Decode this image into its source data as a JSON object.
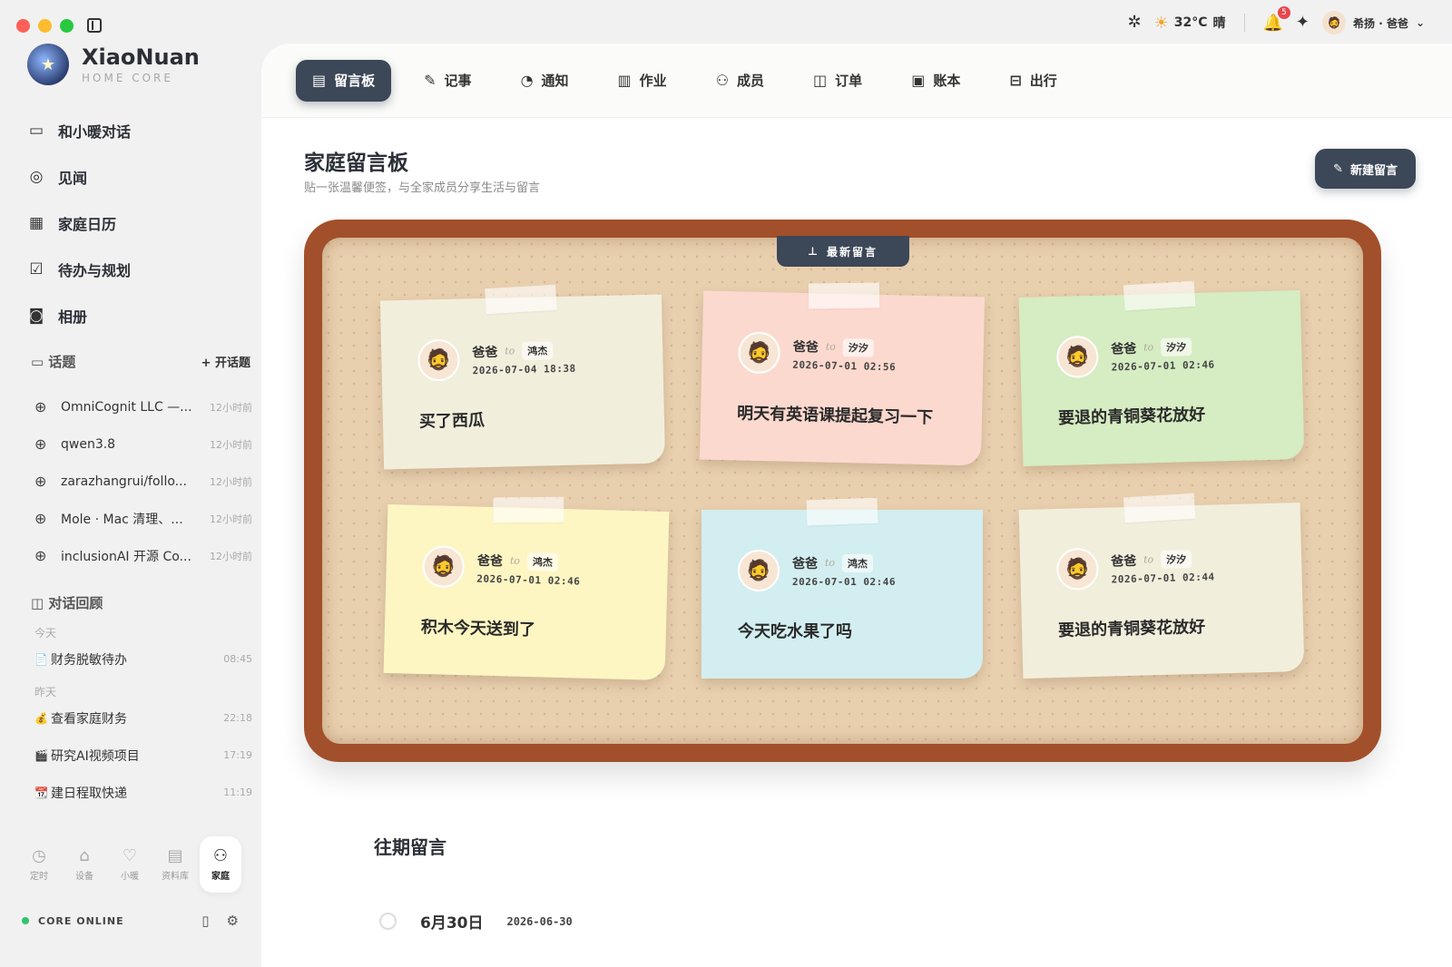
{
  "brand": {
    "name": "XiaoNuan",
    "sub": "HOME CORE"
  },
  "topbar": {
    "temperature": "32°C",
    "weather": "晴",
    "notifications": "5",
    "user": "希扬 · 爸爸"
  },
  "nav": [
    {
      "label": "和小暖对话",
      "icon": "chat-icon"
    },
    {
      "label": "见闻",
      "icon": "compass-icon"
    },
    {
      "label": "家庭日历",
      "icon": "calendar-icon"
    },
    {
      "label": "待办与规划",
      "icon": "checkbox-icon"
    },
    {
      "label": "相册",
      "icon": "camera-icon"
    }
  ],
  "topics": {
    "title": "话题",
    "add_label": "+ 开话题",
    "items": [
      {
        "title": "OmniCognit LLC —...",
        "time": "12小时前"
      },
      {
        "title": "qwen3.8",
        "time": "12小时前"
      },
      {
        "title": "zarazhangrui/follo...",
        "time": "12小时前"
      },
      {
        "title": "Mole · Mac 清理、...",
        "time": "12小时前"
      },
      {
        "title": "inclusionAI 开源 Co...",
        "time": "12小时前"
      }
    ]
  },
  "history": {
    "title": "对话回顾",
    "today_label": "今天",
    "today": [
      {
        "icon": "📄",
        "title": "财务脱敏待办",
        "time": "08:45"
      }
    ],
    "yesterday_label": "昨天",
    "yesterday": [
      {
        "icon": "💰",
        "title": "查看家庭财务",
        "time": "22:18"
      },
      {
        "icon": "🎬",
        "title": "研究AI视频项目",
        "time": "17:19"
      },
      {
        "icon": "📆",
        "title": "建日程取快递",
        "time": "11:19"
      }
    ]
  },
  "dock": [
    {
      "label": "定时",
      "icon": "clock-icon"
    },
    {
      "label": "设备",
      "icon": "router-icon"
    },
    {
      "label": "小暖",
      "icon": "heart-icon"
    },
    {
      "label": "资料库",
      "icon": "archive-icon"
    },
    {
      "label": "家庭",
      "icon": "family-icon"
    }
  ],
  "status": {
    "label": "CORE ONLINE"
  },
  "tabs": [
    {
      "label": "留言板",
      "icon": "board-icon"
    },
    {
      "label": "记事",
      "icon": "edit-icon"
    },
    {
      "label": "通知",
      "icon": "bell-icon"
    },
    {
      "label": "作业",
      "icon": "book-icon"
    },
    {
      "label": "成员",
      "icon": "users-icon"
    },
    {
      "label": "订单",
      "icon": "bag-icon"
    },
    {
      "label": "账本",
      "icon": "wallet-icon"
    },
    {
      "label": "出行",
      "icon": "bus-icon"
    }
  ],
  "page": {
    "title": "家庭留言板",
    "subtitle": "贴一张温馨便签，与全家成员分享生活与留言",
    "new_button": "新建留言",
    "board_tag": "最新留言"
  },
  "notes": [
    {
      "from": "爸爸",
      "to_word": "to",
      "to": "鸿杰",
      "time": "2026-07-04 18:38",
      "text": "买了西瓜",
      "color": "#f2eedc"
    },
    {
      "from": "爸爸",
      "to_word": "to",
      "to": "汐汐",
      "time": "2026-07-01 02:56",
      "text": "明天有英语课提起复习一下",
      "color": "#fcd9cf"
    },
    {
      "from": "爸爸",
      "to_word": "to",
      "to": "汐汐",
      "time": "2026-07-01 02:46",
      "text": "要退的青铜葵花放好",
      "color": "#d6ecc3"
    },
    {
      "from": "爸爸",
      "to_word": "to",
      "to": "鸿杰",
      "time": "2026-07-01 02:46",
      "text": "积木今天送到了",
      "color": "#fdf6c3"
    },
    {
      "from": "爸爸",
      "to_word": "to",
      "to": "鸿杰",
      "time": "2026-07-01 02:46",
      "text": "今天吃水果了吗",
      "color": "#d3eef0"
    },
    {
      "from": "爸爸",
      "to_word": "to",
      "to": "汐汐",
      "time": "2026-07-01 02:44",
      "text": "要退的青铜葵花放好",
      "color": "#f2eedc"
    }
  ],
  "past": {
    "title": "往期留言",
    "date": "6月30日",
    "iso": "2026-06-30"
  }
}
